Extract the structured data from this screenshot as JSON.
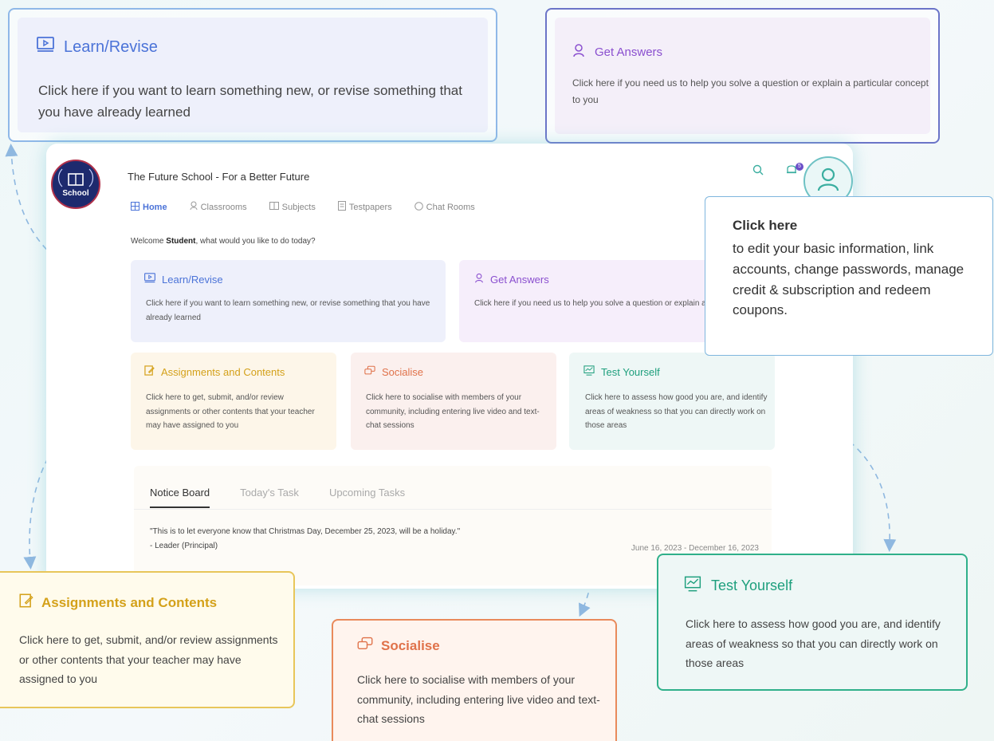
{
  "app": {
    "title": "The Future School - For a Better Future",
    "logo_text": "School",
    "notification_count": "5",
    "nav": [
      {
        "label": "Home"
      },
      {
        "label": "Classrooms"
      },
      {
        "label": "Subjects"
      },
      {
        "label": "Testpapers"
      },
      {
        "label": "Chat Rooms"
      }
    ],
    "welcome": {
      "prefix": "Welcome ",
      "user": "Student",
      "suffix": ", what would you like to do today?"
    },
    "cards": {
      "learn": {
        "title": "Learn/Revise",
        "text": "Click here if you want to learn something new, or revise something that you have already learned"
      },
      "answers": {
        "title": "Get Answers",
        "text": "Click here if you need us to help you solve a question or explain a particular concept to you"
      },
      "assign": {
        "title": "Assignments and Contents",
        "text": "Click here to get, submit, and/or review assignments or other contents that your teacher may have assigned to you"
      },
      "social": {
        "title": "Socialise",
        "text": "Click here to socialise with members of your community, including entering live video and text-chat sessions"
      },
      "test": {
        "title": "Test Yourself",
        "text": "Click here to assess how good you are, and identify areas of weakness so that you can directly work on those areas"
      }
    },
    "notice_board": {
      "tabs": [
        "Notice Board",
        "Today's Task",
        "Upcoming Tasks"
      ],
      "message": "\"This is to let everyone know that Christmas Day, December 25, 2023, will be a holiday.\"",
      "author": "- Leader (Principal)",
      "date_range": "June 16, 2023 - December 16, 2023"
    }
  },
  "callouts": {
    "learn": {
      "title": "Learn/Revise",
      "text": "Click here if you want to learn something new, or revise something that you have already learned"
    },
    "answers": {
      "title": "Get Answers",
      "text": "Click here if you need us to help you solve a question or explain a particular concept to you"
    },
    "profile": {
      "title": "Click here",
      "text": "to edit your basic information, link accounts, change passwords, manage credit & subscription and redeem coupons."
    },
    "assign": {
      "title": "Assignments and Contents",
      "text": "Click here to get, submit, and/or review assignments or other contents that your teacher may have assigned to you"
    },
    "social": {
      "title": "Socialise",
      "text": "Click here to socialise with members of your community, including entering live video and text-chat sessions"
    },
    "test": {
      "title": "Test Yourself",
      "text": "Click here to assess how good you are, and identify areas of weakness so that you can directly work on those areas"
    }
  },
  "colors": {
    "blue": "#4b73d8",
    "purple": "#8a4fcf",
    "yellow": "#d4a11a",
    "orange": "#e0724a",
    "teal": "#1e9f7d",
    "arrow": "#8fb8e0"
  },
  "icons": {
    "learn": "video-lesson-icon",
    "answers": "person-question-icon",
    "assign": "edit-document-icon",
    "social": "chat-bubbles-icon",
    "test": "monitor-chart-icon",
    "search": "search-icon",
    "bell": "bell-icon",
    "avatar": "user-avatar-icon"
  }
}
